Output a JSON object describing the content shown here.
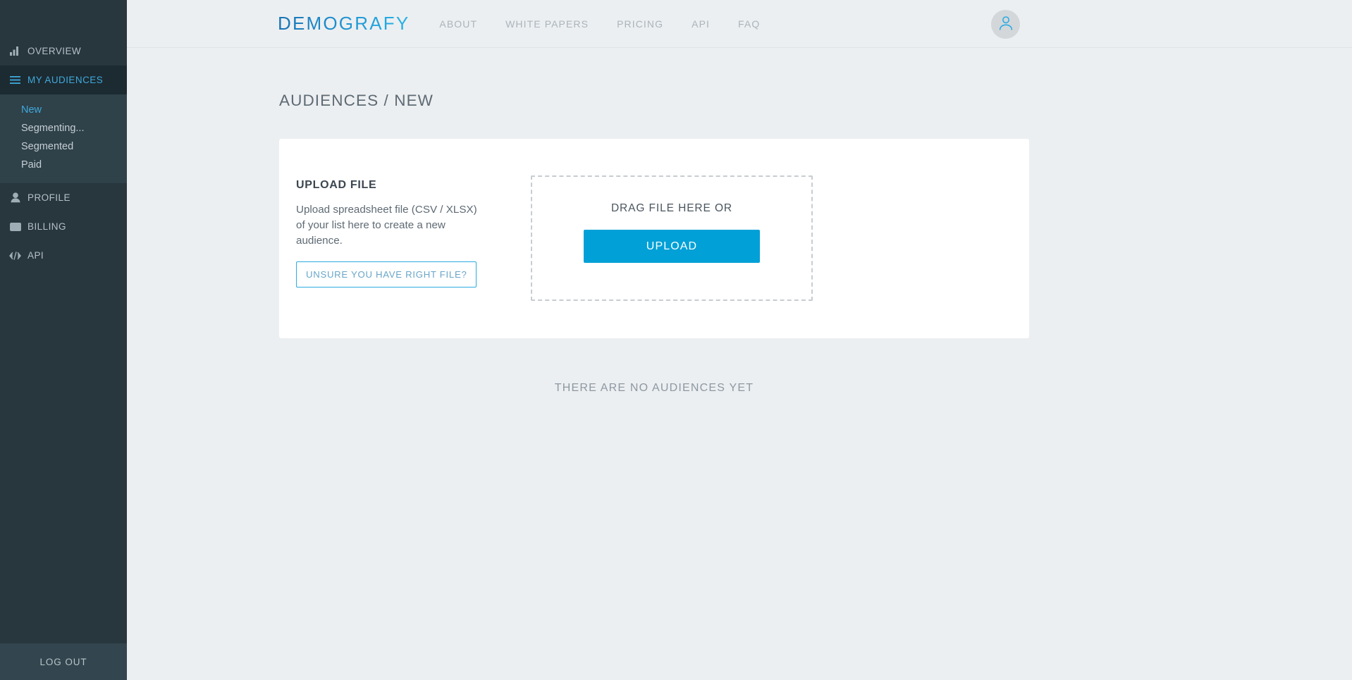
{
  "sidebar": {
    "items": [
      {
        "label": "Overview",
        "icon": "bar-chart-icon",
        "key": "overview",
        "active": false
      },
      {
        "label": "My Audiences",
        "icon": "hamburger-menu-icon",
        "key": "my-audiences",
        "active": true
      },
      {
        "label": "Profile",
        "icon": "person-icon",
        "key": "profile",
        "active": false
      },
      {
        "label": "Billing",
        "icon": "credit-card-icon",
        "key": "billing",
        "active": false
      },
      {
        "label": "API",
        "icon": "code-icon",
        "key": "api",
        "active": false
      }
    ],
    "submenu": [
      {
        "label": "New",
        "current": true
      },
      {
        "label": "Segmenting...",
        "current": false
      },
      {
        "label": "Segmented",
        "current": false
      },
      {
        "label": "Paid",
        "current": false
      }
    ],
    "logout_label": "Log Out",
    "bg_color": "#28363e",
    "active_bg_color": "#1c2a31",
    "submenu_bg_color": "#2f4149",
    "accent_color": "#3fa9dc"
  },
  "header": {
    "logo_text": "DEMOGRAFY",
    "logo_gradient_from": "#1a74b4",
    "logo_gradient_to": "#27b4e8",
    "nav": [
      {
        "label": "About"
      },
      {
        "label": "White Papers"
      },
      {
        "label": "Pricing"
      },
      {
        "label": "API"
      },
      {
        "label": "FAQ"
      }
    ],
    "avatar_icon": "user-avatar-icon"
  },
  "main": {
    "page_title": "Audiences / New",
    "upload_card": {
      "heading": "Upload File",
      "description": "Upload spreadsheet file (CSV / XLSX) of your list here to create a new audience.",
      "help_button_label": "Unsure you have right file?",
      "dropzone_label": "Drag file here or",
      "upload_button_label": "Upload",
      "upload_button_color": "#01a0d7"
    },
    "empty_state": "There are no audiences yet"
  }
}
